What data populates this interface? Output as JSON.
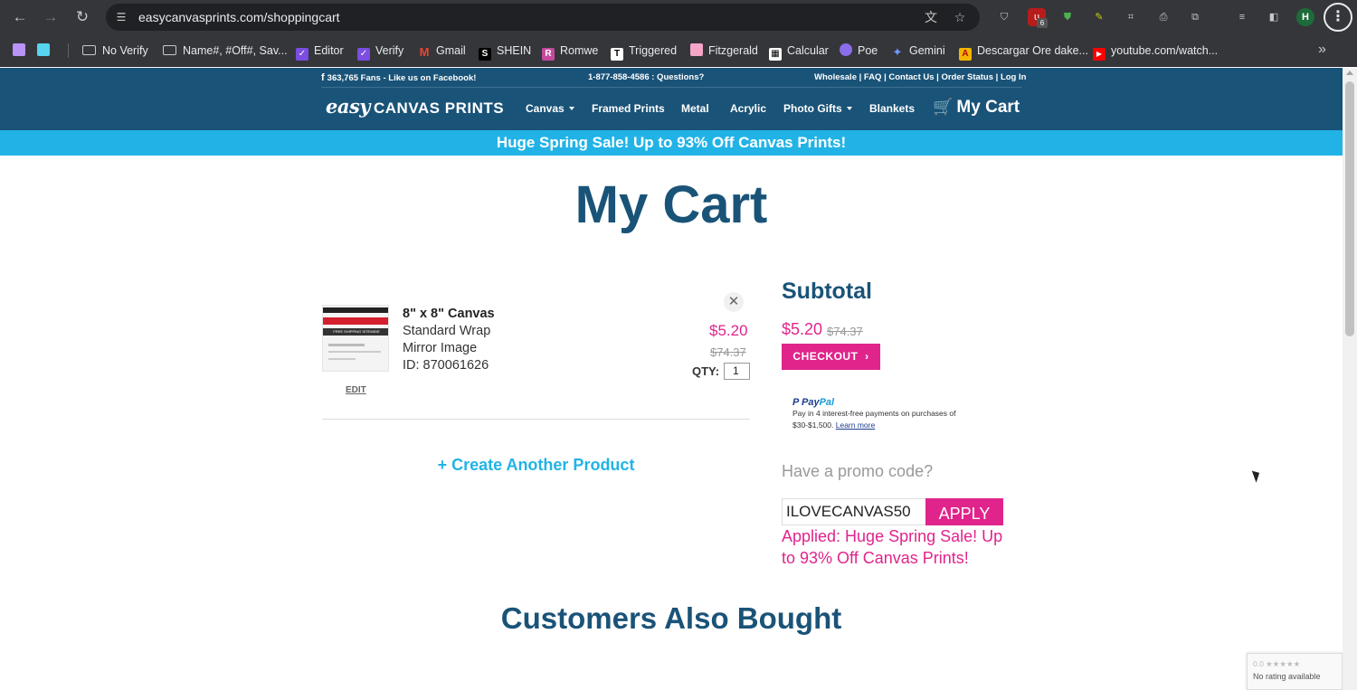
{
  "browser": {
    "url": "easycanvasprints.com/shoppingcart",
    "profile_initial": "H",
    "extension_badge": "6",
    "bookmarks": [
      {
        "label": ""
      },
      {
        "label": ""
      },
      {
        "label": "No Verify"
      },
      {
        "label": "Name#, #Off#, Sav..."
      },
      {
        "label": "Editor"
      },
      {
        "label": "Verify"
      },
      {
        "label": "Gmail"
      },
      {
        "label": "SHEIN"
      },
      {
        "label": "Romwe"
      },
      {
        "label": "Triggered"
      },
      {
        "label": "Fitzgerald"
      },
      {
        "label": "Calcular"
      },
      {
        "label": "Poe"
      },
      {
        "label": "Gemini"
      },
      {
        "label": "Descargar Ore dake..."
      },
      {
        "label": "youtube.com/watch..."
      }
    ]
  },
  "header": {
    "fans": "363,765 Fans - Like us on Facebook!",
    "phone": "1-877-858-4586 : Questions?",
    "util_links": "Wholesale | FAQ | Contact Us | Order Status | Log In",
    "logo_easy": "easy",
    "logo_canvas": "CANVAS PRINTS",
    "nav": [
      "Canvas",
      "Framed Prints",
      "Metal",
      "Acrylic",
      "Photo Gifts",
      "Blankets"
    ],
    "cart": "My Cart"
  },
  "promo_banner": "Huge Spring Sale! Up to 93% Off Canvas Prints!",
  "page_title": "My Cart",
  "item": {
    "name": "8\" x 8\" Canvas",
    "wrap": "Standard Wrap",
    "option": "Mirror Image",
    "id": "ID: 870061626",
    "price": "$5.20",
    "original_price": "$74.37",
    "qty_label": "QTY:",
    "qty": "1",
    "edit": "EDIT",
    "thumb_caption": "FREE SHIPPING SITEWIDE"
  },
  "create_another": "+ Create Another Product",
  "summary": {
    "title": "Subtotal",
    "price": "$5.20",
    "original_price": "$74.37",
    "checkout": "CHECKOUT",
    "paypal_logo_a": "Pay",
    "paypal_logo_b": "Pal",
    "paypal_text": "Pay in 4 interest-free payments on purchases of $30-$1,500.",
    "paypal_learn": "Learn more",
    "promo_question": "Have a promo code?",
    "promo_value": "ILOVECANVAS50",
    "apply": "APPLY",
    "applied_msg": "Applied: Huge Spring Sale! Up to 93% Off Canvas Prints!"
  },
  "also_bought": "Customers Also Bought",
  "recaptcha": {
    "rating": "0.0 ★★★★★",
    "text": "No rating available"
  },
  "colors": {
    "brand_navy": "#1a5378",
    "brand_cyan": "#22b3e6",
    "accent_pink": "#e0248c"
  }
}
